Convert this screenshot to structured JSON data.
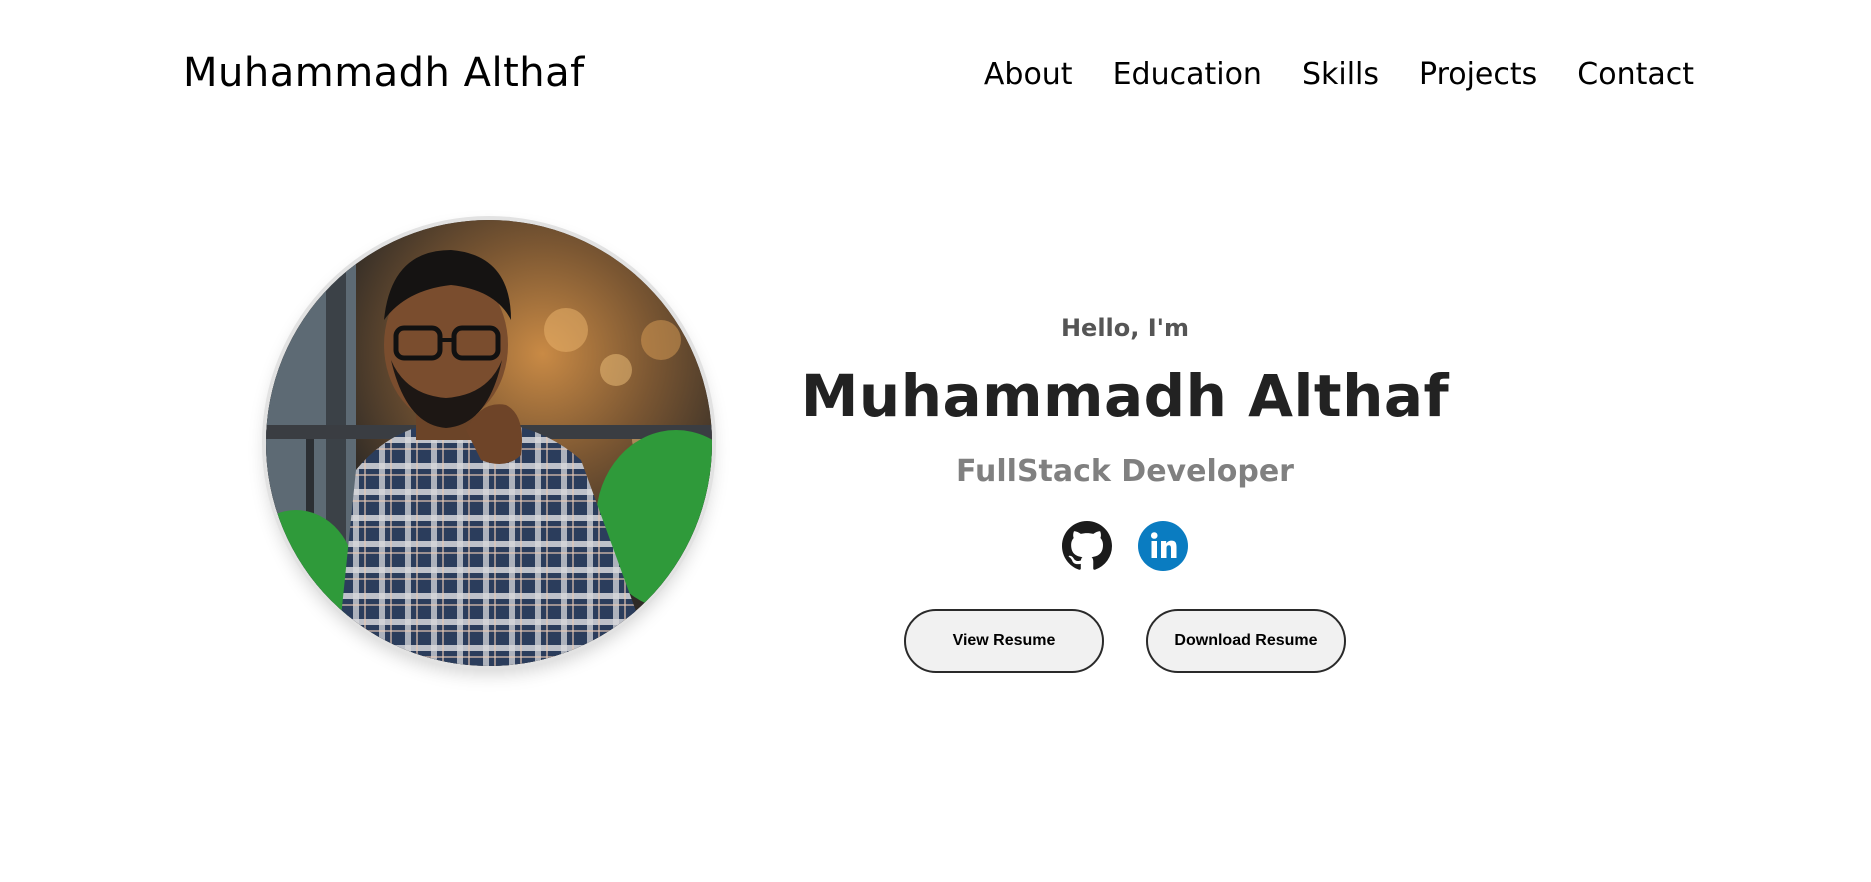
{
  "header": {
    "brand": "Muhammadh Althaf",
    "nav": [
      {
        "label": "About"
      },
      {
        "label": "Education"
      },
      {
        "label": "Skills"
      },
      {
        "label": "Projects"
      },
      {
        "label": "Contact"
      }
    ]
  },
  "hero": {
    "greeting": "Hello, I'm",
    "name": "Muhammadh Althaf",
    "role": "FullStack Developer",
    "photo_alt": "Muhammadh Althaf profile picture",
    "socials": [
      {
        "icon": "github-icon",
        "label": "GitHub"
      },
      {
        "icon": "linkedin-icon",
        "label": "LinkedIn"
      }
    ],
    "buttons": {
      "view_resume": "View Resume",
      "download_resume": "Download Resume"
    }
  },
  "colors": {
    "text_dark": "#222222",
    "text_muted": "#808080",
    "greeting": "#555555",
    "linkedin_blue": "#0a7cc1",
    "button_bg": "#f1f1f1",
    "button_border": "#2a2a2a"
  }
}
